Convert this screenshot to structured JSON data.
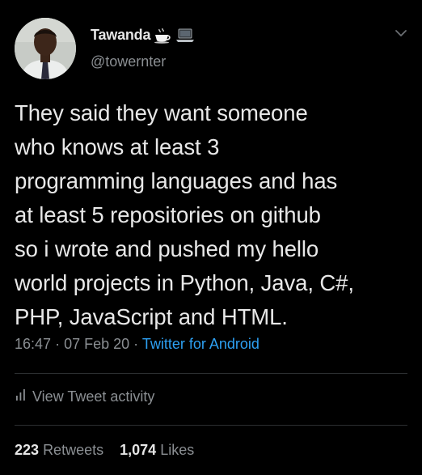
{
  "user": {
    "display_name": "Tawanda",
    "handle": "@towernter",
    "name_emojis": [
      "coffee-cup-icon",
      "laptop-icon"
    ]
  },
  "tweet": {
    "text": "They said they want someone\nwho knows at least 3\nprogramming languages and has\nat least 5 repositories on github\nso i wrote and pushed my hello\nworld projects in Python, Java, C#,\nPHP, JavaScript and HTML.",
    "time": "16:47",
    "date": "07 Feb 20",
    "separator": "·",
    "source": "Twitter for Android"
  },
  "activity": {
    "label": "View Tweet activity"
  },
  "stats": {
    "retweets_count": "223",
    "retweets_label": "Retweets",
    "likes_count": "1,074",
    "likes_label": "Likes"
  },
  "colors": {
    "background": "#000000",
    "primary_text": "#e8e8e8",
    "secondary_text": "#8b8f93",
    "link": "#2da0f2",
    "divider": "#2b2e31"
  }
}
